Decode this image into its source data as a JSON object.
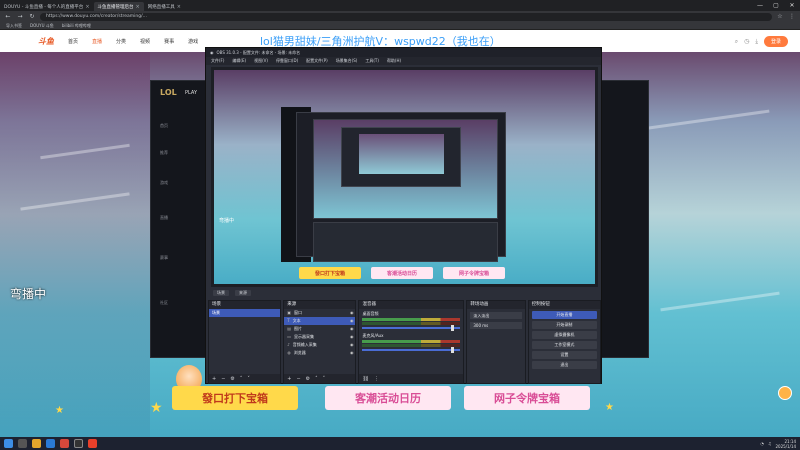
{
  "browser": {
    "tabs": [
      "DOUYU - 斗鱼直播 - 每个人的直播平台",
      "斗鱼直播管理后台",
      "网络直播工具"
    ],
    "url": "https://www.douyu.com/creator/streaming/...",
    "bookmarks": [
      "导入书签",
      "DOUYU 斗鱼",
      "bilibili 哔哩哔哩"
    ]
  },
  "site": {
    "logo": "斗鱼",
    "nav": [
      "首页",
      "直播",
      "分类",
      "视频",
      "赛事",
      "游戏"
    ],
    "login": "登录"
  },
  "overlay_title": "lol猫男甜妹/三角洲护航V：wspwd22（我也在）",
  "page": {
    "live_label": "弯播中",
    "banners": [
      "發口打下宝箱",
      "客潮活动日历",
      "网子令牌宝箱"
    ]
  },
  "nested": {
    "lol_tag": "LOL",
    "lol_play": "PLAY",
    "menu": [
      "首页",
      "推荐",
      "游戏",
      "直播",
      "赛事",
      "社区"
    ]
  },
  "obs": {
    "title": "OBS 31.0.3 - 配置文件: 未命名 - 场景: 未命名",
    "menu": [
      "文件(F)",
      "编辑(E)",
      "视图(V)",
      "停靠窗口(D)",
      "配置文件(P)",
      "场景集合(S)",
      "工具(T)",
      "帮助(H)"
    ],
    "preview_live": "弯播中",
    "preview_banners": [
      "發口打下宝箱",
      "客潮活动日历",
      "网子令牌宝箱"
    ],
    "tabs": [
      "场景",
      "来源"
    ],
    "docks": {
      "scenes": {
        "title": "场景",
        "items": [
          "场景"
        ]
      },
      "sources": {
        "title": "来源",
        "items": [
          "窗口",
          "文本",
          "图片",
          "显示器采集",
          "音频输入采集",
          "浏览器"
        ]
      },
      "mixer": {
        "title": "混音器",
        "channels": [
          "桌面音频",
          "麦克风/Aux"
        ]
      },
      "transitions": {
        "title": "转场动画",
        "field": "淡入淡出",
        "duration": "300 ms"
      },
      "controls": {
        "title": "控制按钮",
        "buttons": [
          "开始直播",
          "开始录制",
          "虚拟摄像机",
          "工作室模式",
          "设置",
          "退出"
        ]
      }
    }
  },
  "taskbar": {
    "time": "21:14",
    "date": "2025/1/14"
  }
}
